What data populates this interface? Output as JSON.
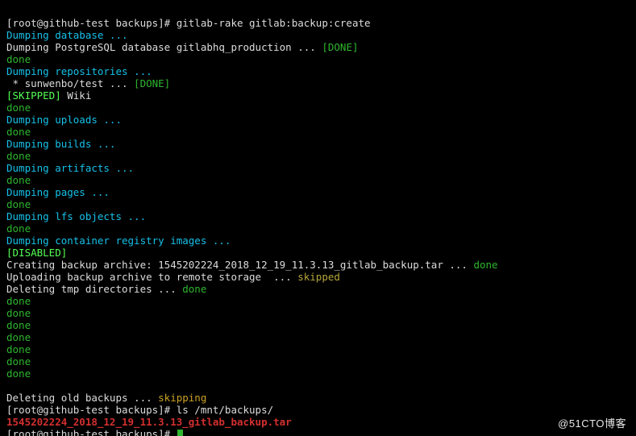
{
  "prompt": {
    "text": "[root@github-test backups]# ",
    "cmd1": "gitlab-rake gitlab:backup:create",
    "cmd2": "ls /mnt/backups/",
    "cmd3_text": "[root@github-test backups]# "
  },
  "lines": {
    "dump_db": "Dumping database ...",
    "dump_pg_a": "Dumping PostgreSQL database gitlabhq_production ... ",
    "dump_pg_done": "[DONE]",
    "done": "done",
    "dump_repos": "Dumping repositories ...",
    "repo_item_a": " * sunwenbo/test ... ",
    "repo_item_done": "[DONE]",
    "skipped_wiki_a": "[SKIPPED]",
    "skipped_wiki_b": " Wiki",
    "dump_uploads": "Dumping uploads ...",
    "dump_builds": "Dumping builds ...",
    "dump_artifacts": "Dumping artifacts ...",
    "dump_pages": "Dumping pages ...",
    "dump_lfs": "Dumping lfs objects ...",
    "dump_registry": "Dumping container registry images ...",
    "disabled": "[DISABLED]",
    "create_archive_a": "Creating backup archive: 1545202224_2018_12_19_11.3.13_gitlab_backup.tar ... ",
    "create_archive_done": "done",
    "upload_a": "Uploading backup archive to remote storage  ... ",
    "upload_skipped": "skipped",
    "deleting_tmp_a": "Deleting tmp directories ... ",
    "deleting_tmp_done": "done",
    "deleting_old_a": "Deleting old backups ... ",
    "deleting_old_skip": "skipping",
    "ls_result": "1545202224_2018_12_19_11.3.13_gitlab_backup.tar"
  },
  "watermark": "@51CTO博客"
}
